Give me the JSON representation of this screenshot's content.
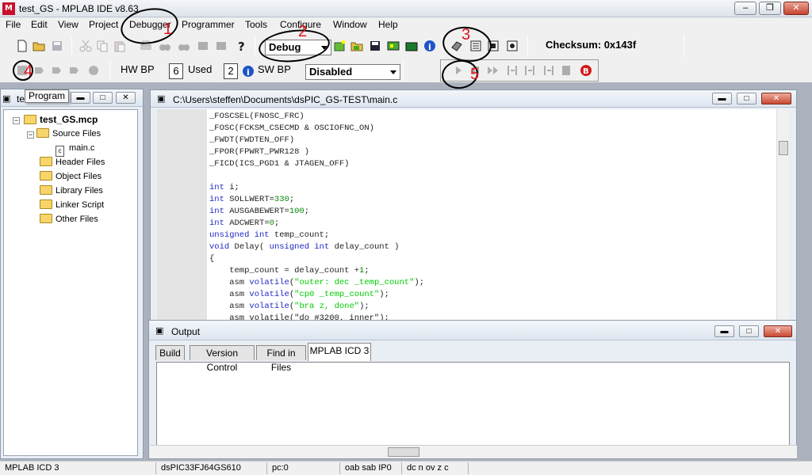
{
  "window": {
    "title": "test_GS - MPLAB IDE v8.63",
    "icon_text": "M"
  },
  "menu": [
    "File",
    "Edit",
    "View",
    "Project",
    "Debugger",
    "Programmer",
    "Tools",
    "Configure",
    "Window",
    "Help"
  ],
  "toolbar": {
    "build_config": "Debug",
    "checksum": "Checksum:  0x143f",
    "hw_bp_label": "HW BP",
    "hw_bp_count": "6",
    "used_label": "Used",
    "sw_bp_count": "2",
    "sw_bp_label": "SW BP",
    "sw_bp_value": "Disabled"
  },
  "tooltip": "Program",
  "project_window": {
    "title": "te",
    "root": "test_GS.mcp",
    "items": [
      "Source Files",
      "main.c",
      "Header Files",
      "Object Files",
      "Library Files",
      "Linker Script",
      "Other Files"
    ]
  },
  "editor": {
    "title": "C:\\Users\\steffen\\Documents\\dsPIC_GS-TEST\\main.c",
    "lines": [
      [
        [
          "_FOSCSEL(FNOSC_FRC)",
          "mac"
        ]
      ],
      [
        [
          "_FOSC(FCKSM_CSECMD & OSCIOFNC_ON)",
          "mac"
        ]
      ],
      [
        [
          "_FWDT(FWDTEN_OFF)",
          "mac"
        ]
      ],
      [
        [
          "_FPOR(FPWRT_PWR128 )",
          "mac"
        ]
      ],
      [
        [
          "_FICD(ICS_PGD1 & JTAGEN_OFF)",
          "mac"
        ]
      ],
      [],
      [
        [
          "int",
          "kw"
        ],
        [
          " i;",
          "mac"
        ]
      ],
      [
        [
          "int",
          "kw"
        ],
        [
          " SOLLWERT=",
          "mac"
        ],
        [
          "330",
          "num"
        ],
        [
          ";",
          "mac"
        ]
      ],
      [
        [
          "int",
          "kw"
        ],
        [
          " AUSGABEWERT=",
          "mac"
        ],
        [
          "100",
          "num"
        ],
        [
          ";",
          "mac"
        ]
      ],
      [
        [
          "int",
          "kw"
        ],
        [
          " ADCWERT=",
          "mac"
        ],
        [
          "0",
          "num"
        ],
        [
          ";",
          "mac"
        ]
      ],
      [
        [
          "unsigned int",
          "kw"
        ],
        [
          " temp_count;",
          "mac"
        ]
      ],
      [
        [
          "void",
          "kw"
        ],
        [
          " Delay( ",
          "mac"
        ],
        [
          "unsigned int",
          "kw"
        ],
        [
          " delay_count )",
          "mac"
        ]
      ],
      [
        [
          "{",
          "mac"
        ]
      ],
      [
        [
          "    temp_count = delay_count +",
          "mac"
        ],
        [
          "1",
          "num"
        ],
        [
          ";",
          "mac"
        ]
      ],
      [
        [
          "    asm ",
          "mac"
        ],
        [
          "volatile",
          "kw"
        ],
        [
          "(",
          "mac"
        ],
        [
          "\"outer: dec _temp_count\"",
          "str"
        ],
        [
          ");",
          "mac"
        ]
      ],
      [
        [
          "    asm ",
          "mac"
        ],
        [
          "volatile",
          "kw"
        ],
        [
          "(",
          "mac"
        ],
        [
          "\"cp0 _temp_count\"",
          "str"
        ],
        [
          ");",
          "mac"
        ]
      ],
      [
        [
          "    asm ",
          "mac"
        ],
        [
          "volatile",
          "kw"
        ],
        [
          "(",
          "mac"
        ],
        [
          "\"bra z, done\"",
          "str"
        ],
        [
          ");",
          "mac"
        ]
      ],
      [
        [
          "    asm volatile(\"do #3200, inner\");",
          "mac"
        ]
      ]
    ]
  },
  "output_window": {
    "title": "Output",
    "tabs": [
      "Build",
      "Version Control",
      "Find in Files",
      "MPLAB ICD 3"
    ],
    "active_tab": "MPLAB ICD 3"
  },
  "status": [
    "MPLAB ICD 3",
    "dsPIC33FJ64GS610",
    "pc:0",
    "oab sab IP0",
    "dc n ov z c"
  ],
  "annotations": [
    "1",
    "2",
    "3",
    "4",
    "5"
  ],
  "colors": {
    "annotation": "#e3141c",
    "keyword": "#1e27c8",
    "string": "#00cc00",
    "number": "#0a8a0a"
  }
}
